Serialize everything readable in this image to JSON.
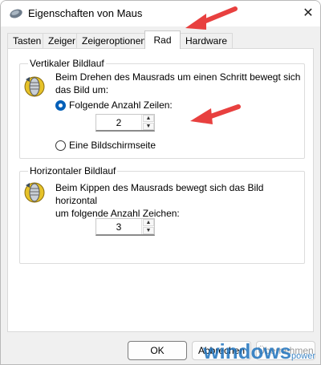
{
  "window": {
    "title": "Eigenschaften von Maus",
    "close_label": "✕"
  },
  "tabs": [
    {
      "label": "Tasten",
      "active": false
    },
    {
      "label": "Zeiger",
      "active": false
    },
    {
      "label": "Zeigeroptionen",
      "active": false
    },
    {
      "label": "Rad",
      "active": true
    },
    {
      "label": "Hardware",
      "active": false
    }
  ],
  "vertical": {
    "title": "Vertikaler Bildlauf",
    "description_line1": "Beim Drehen des Mausrads um einen Schritt bewegt sich",
    "description_line2": "das Bild um:",
    "option_lines_label": "Folgende Anzahl Zeilen:",
    "option_lines_checked": true,
    "lines_value": "2",
    "option_page_label": "Eine Bildschirmseite",
    "option_page_checked": false
  },
  "horizontal": {
    "title": "Horizontaler Bildlauf",
    "description_line1": "Beim Kippen des Mausrads bewegt sich das Bild horizontal",
    "description_line2": "um folgende Anzahl Zeichen:",
    "chars_value": "3"
  },
  "buttons": {
    "ok": "OK",
    "cancel": "Abbrechen",
    "apply": "Übernehmen"
  },
  "watermark": {
    "brand": "windows",
    "suffix": "power"
  },
  "colors": {
    "accent": "#005fb8",
    "annotation_arrow": "#e8403f"
  }
}
